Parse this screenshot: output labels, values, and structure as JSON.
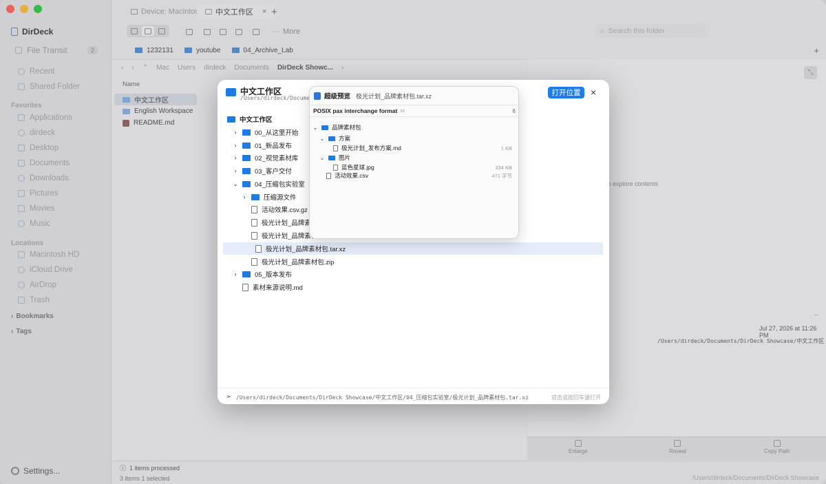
{
  "sidebar": {
    "app_title": "DirDeck",
    "file_transit": {
      "label": "File Transit",
      "count": "2"
    },
    "recent": "Recent",
    "shared": "Shared Folder",
    "favorites_title": "Favorites",
    "favorites": [
      "Applications",
      "dirdeck",
      "Desktop",
      "Documents",
      "Downloads",
      "Pictures",
      "Movies",
      "Music"
    ],
    "locations_title": "Locations",
    "locations": [
      "Macintosh HD",
      "iCloud Drive",
      "AirDrop",
      "Trash"
    ],
    "bookmarks": "Bookmarks",
    "tags": "Tags",
    "settings": "Settings..."
  },
  "tabs": [
    {
      "label": "Device: Macintosh..."
    },
    {
      "label": "中文工作区",
      "close": "×"
    }
  ],
  "tab_plus": "+",
  "toolbar": {
    "more": "More",
    "more_glyph": "···"
  },
  "search": {
    "placeholder": "Search this folder",
    "glyph": "⌕"
  },
  "favbar": {
    "items": [
      "1232131",
      "youtube",
      "04_Archive_Lab"
    ],
    "plus": "+"
  },
  "pathbar": {
    "back": "‹",
    "forward": "›",
    "up": "⌃",
    "segments": [
      "Mac",
      "Users",
      "dirdeck",
      "Documents",
      "DirDeck Showc..."
    ],
    "sep": "›"
  },
  "file_list": {
    "column": "Name",
    "rows": [
      "中文工作区",
      "English Workspace",
      "README.md"
    ]
  },
  "info": {
    "placeholder": "to explore contents",
    "dash": "--",
    "date": "Jul 27, 2026 at 11:26 PM",
    "path": "/Users/dirdeck/Documents/DirDeck Showcase/中文工作区",
    "enlarge": "⤡",
    "actions": [
      "Enlarge",
      "Reveal",
      "Copy Path"
    ]
  },
  "status": {
    "processed": "1 items processed",
    "info_glyph": "ⓘ",
    "summary": "3 items  1 selected",
    "path": "/Users/dirdeck/Documents/DirDeck Showcase"
  },
  "modal": {
    "title": "中文工作区",
    "subtitle": "/Users/dirdeck/Documents/",
    "open_button": "打开位置",
    "close": "×",
    "tree": {
      "root": "中文工作区",
      "items": [
        {
          "label": "00_从这里开始",
          "chev": "›"
        },
        {
          "label": "01_新品发布",
          "chev": "›"
        },
        {
          "label": "02_视觉素材库",
          "chev": "›"
        },
        {
          "label": "03_客户交付",
          "chev": "›"
        },
        {
          "label": "04_压缩包实验室",
          "chev": "⌄"
        },
        {
          "label": "压缩源文件",
          "chev": "›"
        },
        {
          "label": "活动效果.csv.gz"
        },
        {
          "label": "极光计划_品牌素材"
        },
        {
          "label": "极光计划_品牌素材包"
        },
        {
          "label": "极光计划_品牌素材包.tar.xz"
        },
        {
          "label": "极光计划_品牌素材包.zip"
        },
        {
          "label": "05_版本发布",
          "chev": "›"
        },
        {
          "label": "素材来源说明.md"
        }
      ]
    },
    "footer_icon": "➢",
    "footer_path": "/Users/dirdeck/Documents/DirDeck Showcase/中文工作区/04_压缩包实验室/极光计划_品牌素材包.tar.xz",
    "footer_hint": "双击或按回车键打开"
  },
  "preview": {
    "title": "超级预览",
    "file": "极光计划_品牌素材包.tar.xz",
    "format": "POSIX pax interchange format",
    "ext": "xz",
    "count": "6",
    "rows": [
      {
        "label": "品牌素材包",
        "chev": "⌄"
      },
      {
        "label": "方案",
        "chev": "⌄"
      },
      {
        "label": "极光计划_发布方案.md",
        "size": "1 KB"
      },
      {
        "label": "图片",
        "chev": "⌄"
      },
      {
        "label": "蓝色星球.jpg",
        "size": "334 KB"
      },
      {
        "label": "活动效果.csv",
        "size": "471 字节"
      }
    ]
  },
  "colors": {
    "accent": "#1f7be8",
    "close": "#ff5f57",
    "minimize": "#febc2e",
    "zoom": "#28c840"
  }
}
